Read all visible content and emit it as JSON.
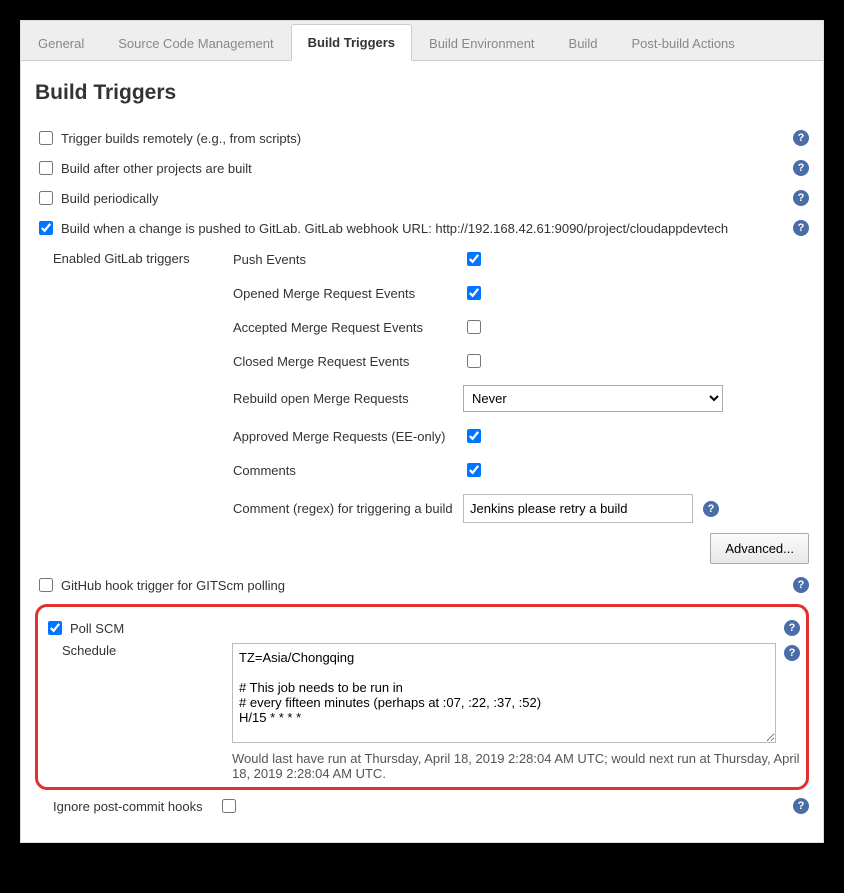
{
  "tabs": {
    "general": "General",
    "scm": "Source Code Management",
    "build_triggers": "Build Triggers",
    "build_env": "Build Environment",
    "build": "Build",
    "post_build": "Post-build Actions"
  },
  "heading": "Build Triggers",
  "triggers": {
    "remote": "Trigger builds remotely (e.g., from scripts)",
    "after_projects": "Build after other projects are built",
    "periodically": "Build periodically",
    "gitlab_push": "Build when a change is pushed to GitLab. GitLab webhook URL: http://192.168.42.61:9090/project/cloudappdevtech",
    "github_hook": "GitHub hook trigger for GITScm polling",
    "poll_scm": "Poll SCM"
  },
  "gitlab": {
    "header": "Enabled GitLab triggers",
    "push_events": "Push Events",
    "opened_mr": "Opened Merge Request Events",
    "accepted_mr": "Accepted Merge Request Events",
    "closed_mr": "Closed Merge Request Events",
    "rebuild_open_mr": "Rebuild open Merge Requests",
    "rebuild_value": "Never",
    "approved_mr": "Approved Merge Requests (EE-only)",
    "comments": "Comments",
    "comment_regex": "Comment (regex) for triggering a build",
    "comment_regex_value": "Jenkins please retry a build",
    "advanced": "Advanced..."
  },
  "schedule": {
    "label": "Schedule",
    "value": "TZ=Asia/Chongqing\n\n# This job needs to be run in\n# every fifteen minutes (perhaps at :07, :22, :37, :52)\nH/15 * * * *",
    "note": "Would last have run at Thursday, April 18, 2019 2:28:04 AM UTC; would next run at Thursday, April 18, 2019 2:28:04 AM UTC."
  },
  "ignore_hooks": "Ignore post-commit hooks",
  "help_glyph": "?"
}
